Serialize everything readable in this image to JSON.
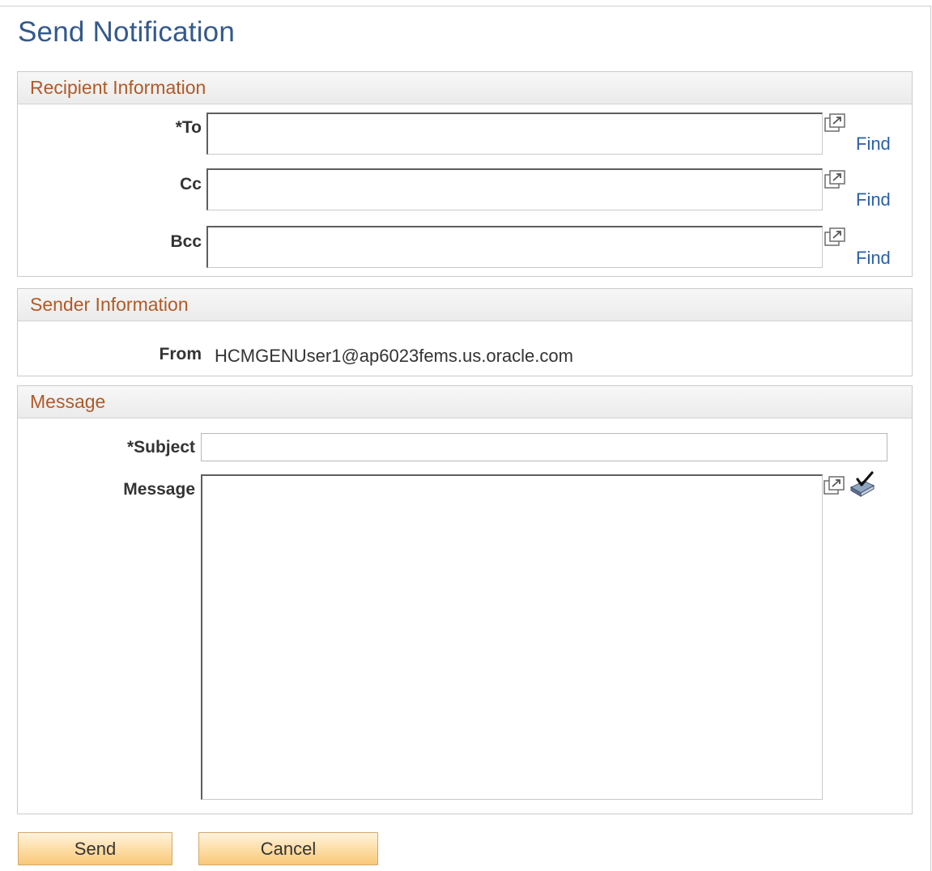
{
  "page": {
    "title": "Send Notification"
  },
  "recipient": {
    "header": "Recipient Information",
    "rows": [
      {
        "label": "*To",
        "value": "",
        "find": "Find"
      },
      {
        "label": "Cc",
        "value": "",
        "find": "Find"
      },
      {
        "label": "Bcc",
        "value": "",
        "find": "Find"
      }
    ]
  },
  "sender": {
    "header": "Sender Information",
    "from_label": "From",
    "from_value": "HCMGENUser1@ap6023fems.us.oracle.com"
  },
  "message": {
    "header": "Message",
    "subject_label": "*Subject",
    "subject_value": "",
    "message_label": "Message",
    "message_value": ""
  },
  "buttons": {
    "send": "Send",
    "cancel": "Cancel"
  },
  "icons": {
    "expand": "expand-field-icon",
    "spellcheck": "spell-check-icon"
  },
  "colors": {
    "title": "#34598c",
    "section_header": "#b05a28",
    "link": "#2a5fa9",
    "button": "#fddca3"
  }
}
